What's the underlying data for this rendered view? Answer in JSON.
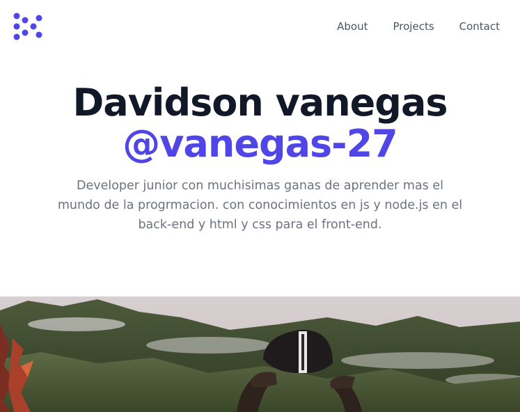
{
  "header": {
    "logo_icon": "brand-logo-icon",
    "brand_color": "#4f46e5",
    "nav": [
      {
        "label": "About"
      },
      {
        "label": "Projects"
      },
      {
        "label": "Contact"
      }
    ]
  },
  "hero": {
    "title": "Davidson vanegas",
    "handle": "@vanegas-27",
    "description": "Developer junior con muchisimas ganas de aprender mas el mundo de la progrmacion. con conocimientos en js y node.js en el back-end y html y css para el front-end."
  },
  "photo": {
    "subject": "person-wearing-cap-in-mountains"
  },
  "colors": {
    "title": "#111827",
    "accent": "#4f46e5",
    "body_text": "#6b7280",
    "nav_text": "#4b5563"
  }
}
